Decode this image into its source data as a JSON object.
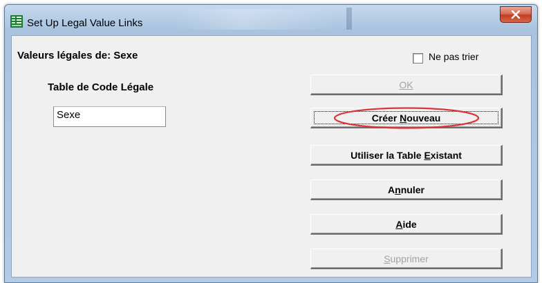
{
  "window": {
    "title": "Set Up Legal Value Links",
    "close_label": "X"
  },
  "dialog": {
    "values_label": "Valeurs légales de:",
    "values_field": "Sexe",
    "table_label": "Table de Code Légale",
    "table_input_value": "Sexe",
    "no_sort_label": "Ne pas trier",
    "no_sort_checked": false
  },
  "buttons": {
    "ok": {
      "label": "OK",
      "enabled": false
    },
    "create_new": {
      "prefix": "Créer ",
      "mnemonic": "N",
      "suffix": "ouveau",
      "enabled": true
    },
    "use_existing": {
      "prefix": "Utiliser la Table ",
      "mnemonic": "E",
      "suffix": "xistant",
      "enabled": true
    },
    "cancel": {
      "prefix": "A",
      "mnemonic": "n",
      "suffix": "nuler",
      "enabled": true
    },
    "help": {
      "prefix": "",
      "mnemonic": "A",
      "suffix": "ide",
      "enabled": true
    },
    "delete": {
      "prefix": "",
      "mnemonic": "S",
      "suffix": "upprimer",
      "enabled": false
    }
  },
  "annotation": {
    "color": "#d9343a",
    "shape": "ellipse"
  },
  "colors": {
    "close_button": "#c8452b",
    "titlebar": "#b8cfe7",
    "dialog_bg": "#f0f0f0",
    "disabled_text": "#a3a3a3"
  }
}
